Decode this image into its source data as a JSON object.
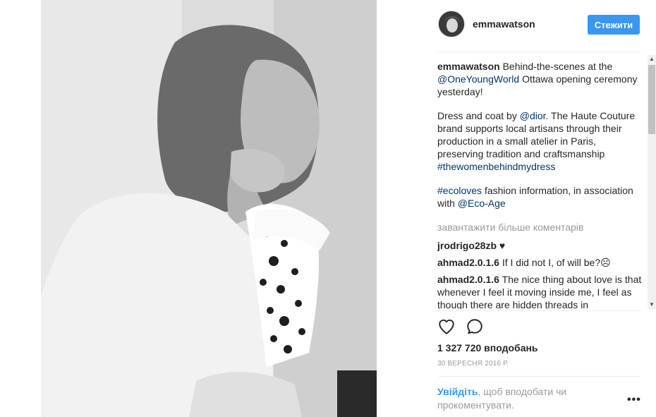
{
  "post": {
    "username": "emmawatson",
    "follow_label": "Стежити"
  },
  "caption": {
    "username": "emmawatson",
    "text_1": "Behind-the-scenes at the",
    "mention_1": "@OneYoungWorld",
    "text_2": "Ottawa opening ceremony yesterday!",
    "text_3": "Dress and coat by",
    "mention_2": "@dior",
    "text_4": ". The Haute Couture brand supports local artisans through their production in a small atelier in Paris, preserving tradition and craftsmanship",
    "hashtag_1": "#thewomenbehindmydress",
    "hashtag_2": "#ecoloves",
    "text_5": "fashion information, in association with",
    "mention_3": "@Eco-Age"
  },
  "load_more": "завантажити більше коментарів",
  "comments": [
    {
      "user": "jrodrigo28zb",
      "text": "♥"
    },
    {
      "user": "ahmad2.0.1.6",
      "text": "If I did not I, of will be?☹"
    },
    {
      "user": "ahmad2.0.1.6",
      "text": "The nice thing about love is that whenever I feel it moving inside me, I feel as though there are hidden threads in"
    }
  ],
  "likes": "1 327 720 вподобань",
  "date": "30 ВЕРЕСНЯ 2016 Р.",
  "login": {
    "link": "Увійдіть",
    "text": ", щоб вподобати чи прокоментувати."
  },
  "more_menu": "•••",
  "icons": {
    "like": "heart-icon",
    "comment": "comment-icon",
    "more": "more-options-icon"
  },
  "colors": {
    "accent": "#3897f0",
    "link": "#003569",
    "muted": "#999999"
  }
}
